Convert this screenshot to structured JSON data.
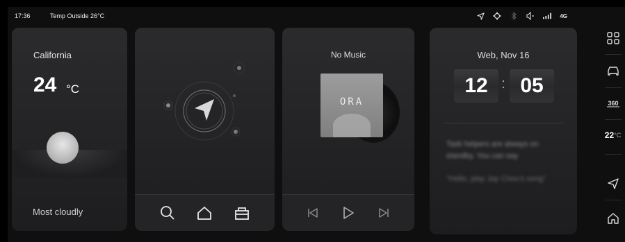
{
  "status_bar": {
    "time": "17:36",
    "temp_outside": "Temp Outside 26°C",
    "network": "4G",
    "icons": [
      "navigation-arrow-icon",
      "gps-icon",
      "bluetooth-icon",
      "volume-icon",
      "signal-icon"
    ]
  },
  "weather": {
    "city": "California",
    "temperature": "24",
    "unit": "°C",
    "condition": "Most cloudly",
    "icon": "sun-icon"
  },
  "navigation": {
    "icon": "compass-arrow-icon",
    "toolbar": [
      {
        "name": "search-icon"
      },
      {
        "name": "home-icon"
      },
      {
        "name": "office-icon"
      }
    ]
  },
  "music": {
    "title": "No Music",
    "album_logo": "ORA",
    "controls": [
      {
        "name": "previous-icon"
      },
      {
        "name": "play-icon"
      },
      {
        "name": "next-icon"
      }
    ]
  },
  "clock": {
    "date": "Web, Nov 16",
    "hours": "12",
    "minutes": "05",
    "tip_primary": "Task helpers are always on standby. You can say",
    "tip_secondary": "\"Hello, play Jay Chou's song\""
  },
  "dock": {
    "temperature": "22",
    "temperature_unit": "°C",
    "items": [
      "apps-grid-icon",
      "car-icon",
      "360-view-icon",
      "climate-temp",
      "navigation-icon",
      "home-icon"
    ]
  },
  "colors": {
    "background": "#0f0f10",
    "card": "#2b2b2d",
    "text": "#e8e8e8"
  }
}
